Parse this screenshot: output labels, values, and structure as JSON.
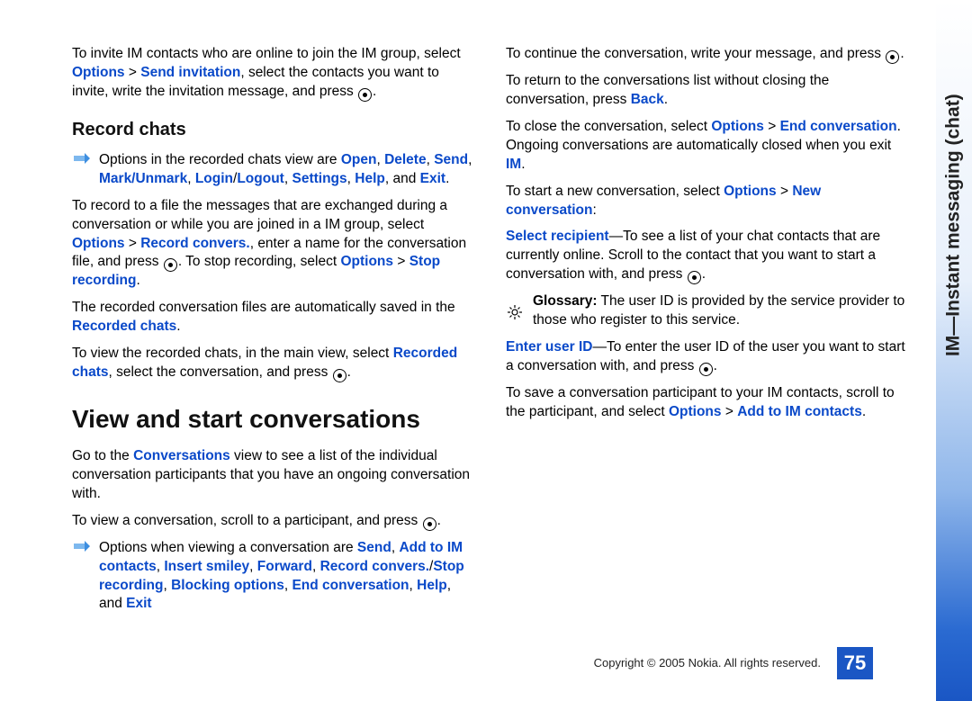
{
  "side_label": "IM—Instant messaging (chat)",
  "page_number": "75",
  "copyright": "Copyright © 2005 Nokia. All rights reserved.",
  "h_record": "Record chats",
  "h_view": "View and start conversations",
  "p1_a": "To invite IM contacts who are online to join the IM group, select ",
  "p1_b": "Options",
  "p1_c": " > ",
  "p1_d": "Send invitation",
  "p1_e": ", select the contacts you want to invite, write the invitation message, and press ",
  "p1_f": ".",
  "n1_a": "Options in the recorded chats view are ",
  "n1_open": "Open",
  "n1_delete": "Delete",
  "n1_send": "Send",
  "n1_mark": "Mark/Unmark",
  "n1_login": "Login",
  "n1_logout": "Logout",
  "n1_settings": "Settings",
  "n1_help": "Help",
  "n1_exit": "Exit",
  "n1_and": ", and ",
  "p2_a": "To record to a file the messages that are exchanged during a conversation or while you are joined in a IM group, select ",
  "p2_b": "Options",
  "p2_c": " > ",
  "p2_d": "Record convers.",
  "p2_e": ", enter a name for the conversation file, and press ",
  "p2_f": ". To stop recording, select ",
  "p2_g": "Options",
  "p2_h": " > ",
  "p2_i": "Stop recording",
  "p2_j": ".",
  "p3_a": "The recorded conversation files are automatically saved in the ",
  "p3_b": "Recorded chats",
  "p3_c": ".",
  "p4_a": "To view the recorded chats, in the main view, select ",
  "p4_b": "Recorded chats",
  "p4_c": ", select the conversation, and press ",
  "p4_d": ".",
  "p5_a": "Go to the ",
  "p5_b": "Conversations",
  "p5_c": " view to see a list of the individual conversation participants that you have an ongoing conversation with.",
  "p6_a": "To view a conversation, scroll to a participant, and press ",
  "p6_b": ".",
  "n2_a": "Options when viewing a conversation are ",
  "n2_send": "Send",
  "n2_add": "Add to IM contacts",
  "n2_smiley": "Insert smiley",
  "n2_fwd": "Forward",
  "n2_rec": "Record convers.",
  "n2_stop": "Stop recording",
  "n2_block": "Blocking options",
  "n2_end": "End conversation",
  "n2_help": "Help",
  "n2_exit": "Exit",
  "n2_and": ", and ",
  "p7_a": "To continue the conversation, write your message, and press ",
  "p7_b": ".",
  "p8_a": "To return to the conversations list without closing the conversation, press ",
  "p8_b": "Back",
  "p8_c": ".",
  "p9_a": "To close the conversation, select ",
  "p9_b": "Options",
  "p9_c": " > ",
  "p9_d": "End conversation",
  "p9_e": ". Ongoing conversations are automatically closed when you exit ",
  "p9_f": "IM",
  "p9_g": ".",
  "p10_a": "To start a new conversation, select ",
  "p10_b": "Options",
  "p10_c": " > ",
  "p10_d": "New conversation",
  "p10_e": ":",
  "p11_a": "Select recipient",
  "p11_b": "—To see a list of your chat contacts that are currently online. Scroll to the contact that you want to start a conversation with, and press ",
  "p11_c": ".",
  "g_label": "Glossary:",
  "g_text": " The user ID is provided by the service provider to those who register to this service.",
  "p12_a": "Enter user ID",
  "p12_b": "—To enter the user ID of the user you want to start a conversation with, and press ",
  "p12_c": ".",
  "p13_a": "To save a conversation participant to your IM contacts, scroll to the participant, and select ",
  "p13_b": "Options",
  "p13_c": " > ",
  "p13_d": "Add to IM contacts",
  "p13_e": "."
}
